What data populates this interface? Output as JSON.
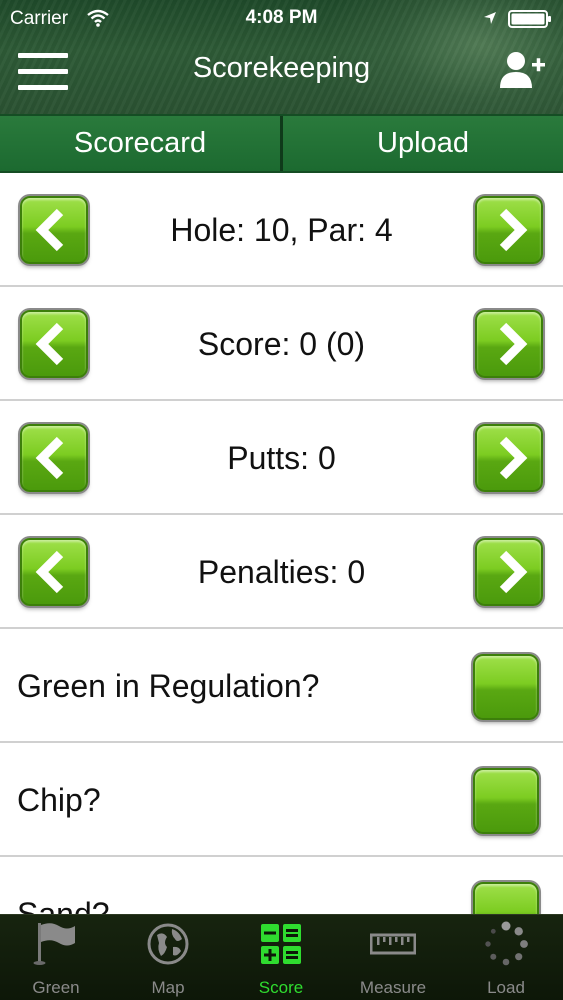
{
  "status_bar": {
    "carrier": "Carrier",
    "time": "4:08 PM"
  },
  "nav": {
    "title": "Scorekeeping"
  },
  "tabs": [
    {
      "label": "Scorecard"
    },
    {
      "label": "Upload"
    }
  ],
  "steppers": [
    {
      "label": "Hole: 10, Par: 4"
    },
    {
      "label": "Score: 0 (0)"
    },
    {
      "label": "Putts: 0"
    },
    {
      "label": "Penalties: 0"
    }
  ],
  "checks": [
    {
      "label": "Green in Regulation?"
    },
    {
      "label": "Chip?"
    },
    {
      "label": "Sand?"
    }
  ],
  "tabbar": [
    {
      "label": "Green",
      "icon": "flag-icon"
    },
    {
      "label": "Map",
      "icon": "globe-icon"
    },
    {
      "label": "Score",
      "icon": "calculator-icon",
      "active": true
    },
    {
      "label": "Measure",
      "icon": "ruler-icon"
    },
    {
      "label": "Load",
      "icon": "spinner-icon"
    }
  ],
  "colors": {
    "accent_green": "#2fdc2f",
    "button_green": "#7ccc21",
    "header_green": "#2d5a36"
  }
}
